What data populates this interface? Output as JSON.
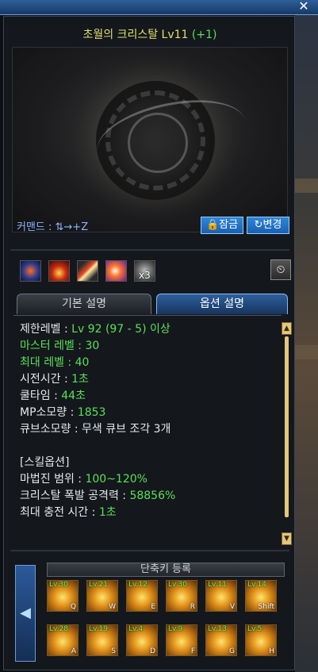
{
  "window": {
    "close_label": "✕"
  },
  "skill": {
    "name": "초월의 크리스탈 Lv11",
    "plus": "(+1)"
  },
  "command": "커맨드 : ⇅→+Z",
  "buttons": {
    "lock": "🔒잠금",
    "change": "↻변경"
  },
  "icon_row": {
    "stack_label": "x3",
    "clock": "⏲"
  },
  "tabs": {
    "basic": "기본 설명",
    "option": "옵션 설명"
  },
  "description": {
    "req_level_label": "제한레벨 : ",
    "req_level_value": "Lv 92 (97 - 5) 이상",
    "master_level": "마스터 레벨 : 30",
    "max_level": "최대 레벨 : 40",
    "cast_label": "시전시간 : ",
    "cast_value": "1초",
    "cooldown_label": "쿨타임 : ",
    "cooldown_value": "44초",
    "mp_label": "MP소모량 : ",
    "mp_value": "1853",
    "cube_text": "큐브소모량 : 무색 큐브 조각 3개",
    "skill_option_header": "[스킬옵션]",
    "range_label": "마법진 범위 : ",
    "range_value": "100~120%",
    "burst_label": "크리스탈 폭발 공격력 : ",
    "burst_value": "58856%",
    "charge_label": "최대 충전 시간 : ",
    "charge_value": "1초"
  },
  "hotkeys": {
    "title": "단축키 등록",
    "items": [
      {
        "lv": "Lv.30",
        "key": "Q"
      },
      {
        "lv": "Lv.21",
        "key": "W"
      },
      {
        "lv": "Lv.12",
        "key": "E"
      },
      {
        "lv": "Lv.30",
        "key": "R"
      },
      {
        "lv": "Lv.11",
        "key": "V"
      },
      {
        "lv": "Lv.14",
        "key": "Shift"
      },
      {
        "lv": "Lv.28",
        "key": "A"
      },
      {
        "lv": "Lv.19",
        "key": "S"
      },
      {
        "lv": "Lv.4",
        "key": "D"
      },
      {
        "lv": "Lv.9",
        "key": "F"
      },
      {
        "lv": "Lv.13",
        "key": "G"
      },
      {
        "lv": "Lv.5",
        "key": "H"
      }
    ]
  }
}
